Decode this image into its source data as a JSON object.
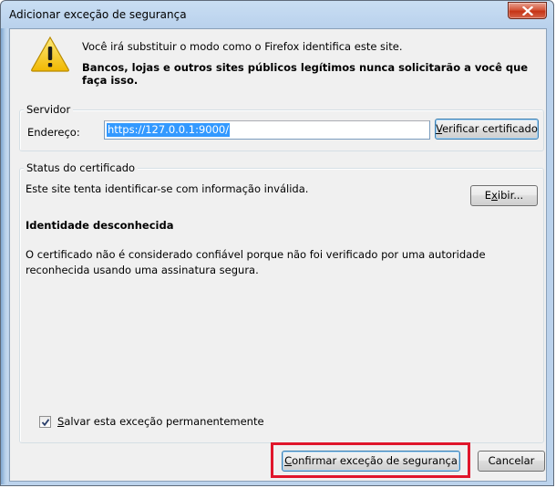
{
  "dialog": {
    "title": "Adicionar exceção de segurança"
  },
  "warning": {
    "line1": "Você irá substituir o modo como o Firefox identifica este site.",
    "line2": "Bancos, lojas e outros sites públicos legítimos nunca solicitarão a você que faça isso."
  },
  "server": {
    "group_label": "Servidor",
    "address_label": "Endereço:",
    "address_value": "https://127.0.0.1:9000/",
    "verify_button_key": "V",
    "verify_button_rest": "erificar certificado"
  },
  "status": {
    "group_label": "Status do certificado",
    "line1": "Este site tenta identificar-se com informação inválida.",
    "view_button_pre": "E",
    "view_button_key": "x",
    "view_button_rest": "ibir...",
    "identity_heading": "Identidade desconhecida",
    "explanation": "O certificado não é considerado confiável porque não foi verificado por uma autoridade reconhecida usando uma assinatura segura."
  },
  "permanent": {
    "checked": true,
    "label_key": "S",
    "label_rest": "alvar esta exceção permanentemente"
  },
  "actions": {
    "confirm_key": "C",
    "confirm_rest": "onfirmar exceção de segurança",
    "cancel_label": "Cancelar"
  },
  "colors": {
    "highlight": "#e0162b",
    "selection": "#3399ff",
    "warning_icon": "#f5c400"
  },
  "icons": {
    "warning": "warning-triangle-icon",
    "close": "close-icon",
    "check": "checkmark-icon"
  }
}
